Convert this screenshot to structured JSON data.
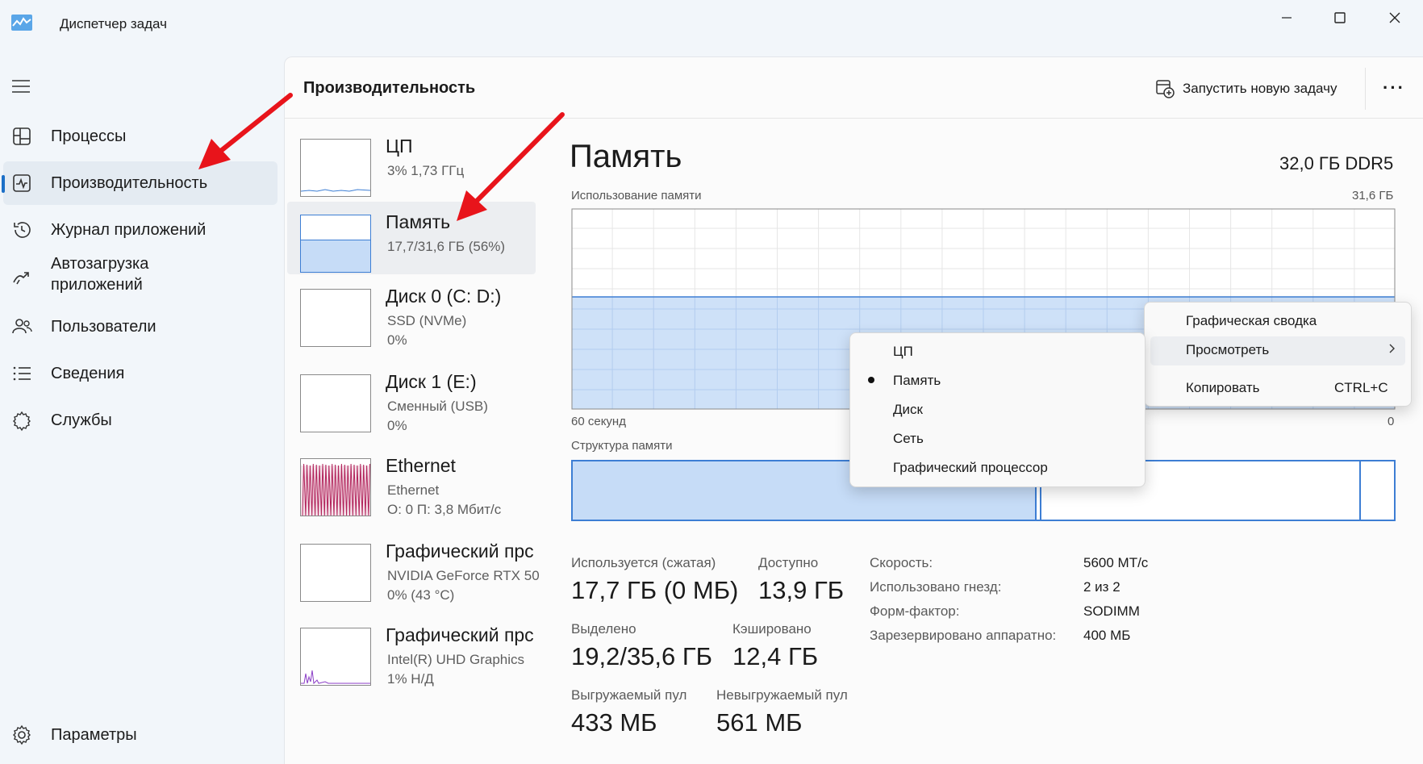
{
  "window": {
    "title": "Диспетчер задач",
    "controls": [
      "minimize-icon",
      "maximize-icon",
      "close-icon"
    ]
  },
  "sidebar": {
    "items": [
      {
        "label": "Процессы",
        "icon": "processes-icon"
      },
      {
        "label": "Производительность",
        "icon": "performance-icon",
        "active": true
      },
      {
        "label": "Журнал приложений",
        "icon": "history-icon"
      },
      {
        "label": "Автозагрузка\nприложений",
        "icon": "startup-icon"
      },
      {
        "label": "Пользователи",
        "icon": "users-icon"
      },
      {
        "label": "Сведения",
        "icon": "details-icon"
      },
      {
        "label": "Службы",
        "icon": "services-icon"
      }
    ],
    "settings": {
      "label": "Параметры",
      "icon": "gear-icon"
    }
  },
  "header": {
    "title": "Производительность",
    "run_task_label": "Запустить новую задачу",
    "more_label": "···"
  },
  "devices": [
    {
      "name": "ЦП",
      "sub1": "3%  1,73 ГГц",
      "sub2": ""
    },
    {
      "name": "Память",
      "sub1": "17,7/31,6 ГБ (56%)",
      "sub2": "",
      "selected": true,
      "fill": 0.56
    },
    {
      "name": "Диск 0 (C: D:)",
      "sub1": "SSD (NVMe)",
      "sub2": "0%"
    },
    {
      "name": "Диск 1 (E:)",
      "sub1": "Сменный (USB)",
      "sub2": "0%"
    },
    {
      "name": "Ethernet",
      "sub1": "Ethernet",
      "sub2": "О: 0  П: 3,8 Мбит/с"
    },
    {
      "name": "Графический прс",
      "sub1": "NVIDIA GeForce RTX 50",
      "sub2": "0%  (43 °C)"
    },
    {
      "name": "Графический прс",
      "sub1": "Intel(R) UHD Graphics",
      "sub2": "1%  Н/Д"
    }
  ],
  "memory": {
    "title": "Память",
    "type": "32,0 ГБ DDR5",
    "usage_label": "Использование памяти",
    "usage_max": "31,6 ГБ",
    "usage_fraction": 0.56,
    "time_left": "60 секунд",
    "time_right": "0",
    "structure_label": "Структура памяти",
    "stats": {
      "in_use_label": "Используется (сжатая)",
      "in_use_value": "17,7 ГБ (0 МБ)",
      "available_label": "Доступно",
      "available_value": "13,9 ГБ",
      "committed_label": "Выделено",
      "committed_value": "19,2/35,6 ГБ",
      "cached_label": "Кэшировано",
      "cached_value": "12,4 ГБ",
      "paged_label": "Выгружаемый пул",
      "paged_value": "433 МБ",
      "nonpaged_label": "Невыгружаемый пул",
      "nonpaged_value": "561 МБ"
    },
    "specs": [
      {
        "label": "Скорость:",
        "value": "5600 МТ/с"
      },
      {
        "label": "Использовано гнезд:",
        "value": "2 из 2"
      },
      {
        "label": "Форм-фактор:",
        "value": "SODIMM"
      },
      {
        "label": "Зарезервировано аппаратно:",
        "value": "400 МБ"
      }
    ]
  },
  "context_menu": {
    "graph_summary": "Графическая сводка",
    "view": "Просмотреть",
    "copy": "Копировать",
    "copy_shortcut": "CTRL+C"
  },
  "submenu": {
    "items": [
      "ЦП",
      "Память",
      "Диск",
      "Сеть",
      "Графический процессор"
    ],
    "selected": "Память"
  },
  "colors": {
    "accent": "#1c6fc7",
    "memory_fill": "#c6dcf7",
    "memory_line": "#3d7ed4",
    "ethernet": "#b1235b",
    "annotation_arrow": "#e8141b"
  }
}
